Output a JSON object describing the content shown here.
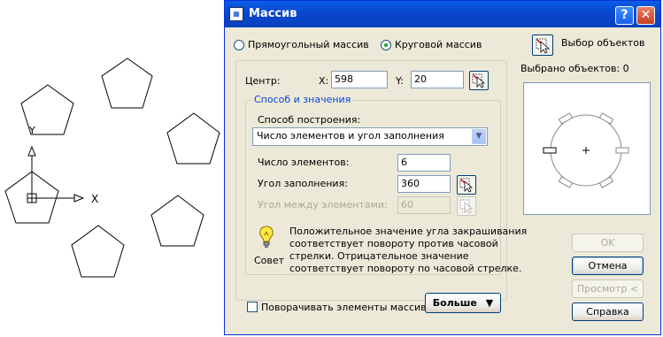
{
  "dialog": {
    "title": "Массив",
    "title_icon": "array-icon",
    "help_button": "?",
    "close_button": "✕"
  },
  "array_type": {
    "rect_label": "Прямоугольный массив",
    "polar_label": "Круговой массив",
    "selected": "polar"
  },
  "select_objects": {
    "label": "Выбор объектов",
    "selected_count": "Выбрано объектов: 0"
  },
  "center": {
    "label": "Центр:",
    "x_label": "X:",
    "x_value": "598",
    "y_label": "Y:",
    "y_value": "20"
  },
  "method": {
    "group_title": "Способ и значения",
    "build_label": "Способ построения:",
    "build_value": "Число элементов и угол заполнения",
    "count_label": "Число элементов:",
    "count_value": "6",
    "fill_angle_label": "Угол заполнения:",
    "fill_angle_value": "360",
    "between_label": "Угол между элементами:",
    "between_value": "60"
  },
  "tip": {
    "label": "Совет",
    "text_lines": [
      "Положительное значение угла закрашивания",
      "соответствует повороту против часовой",
      "стрелки. Отрицательное значение",
      "соответствует повороту по часовой стрелке."
    ]
  },
  "rotate_items": {
    "label": "Поворачивать элементы массива",
    "checked": false
  },
  "more_button": "Больше",
  "buttons": {
    "ok": "OK",
    "cancel": "Отмена",
    "preview": "Просмотр <",
    "help": "Справка"
  },
  "drawing": {
    "ucs_x_label": "X",
    "ucs_y_label": "Y"
  },
  "colors": {
    "title_bar": "#0846CE",
    "dialog_bg": "#ECE9D8",
    "group_title": "#0046D5",
    "radio_dot": "#21A121"
  }
}
